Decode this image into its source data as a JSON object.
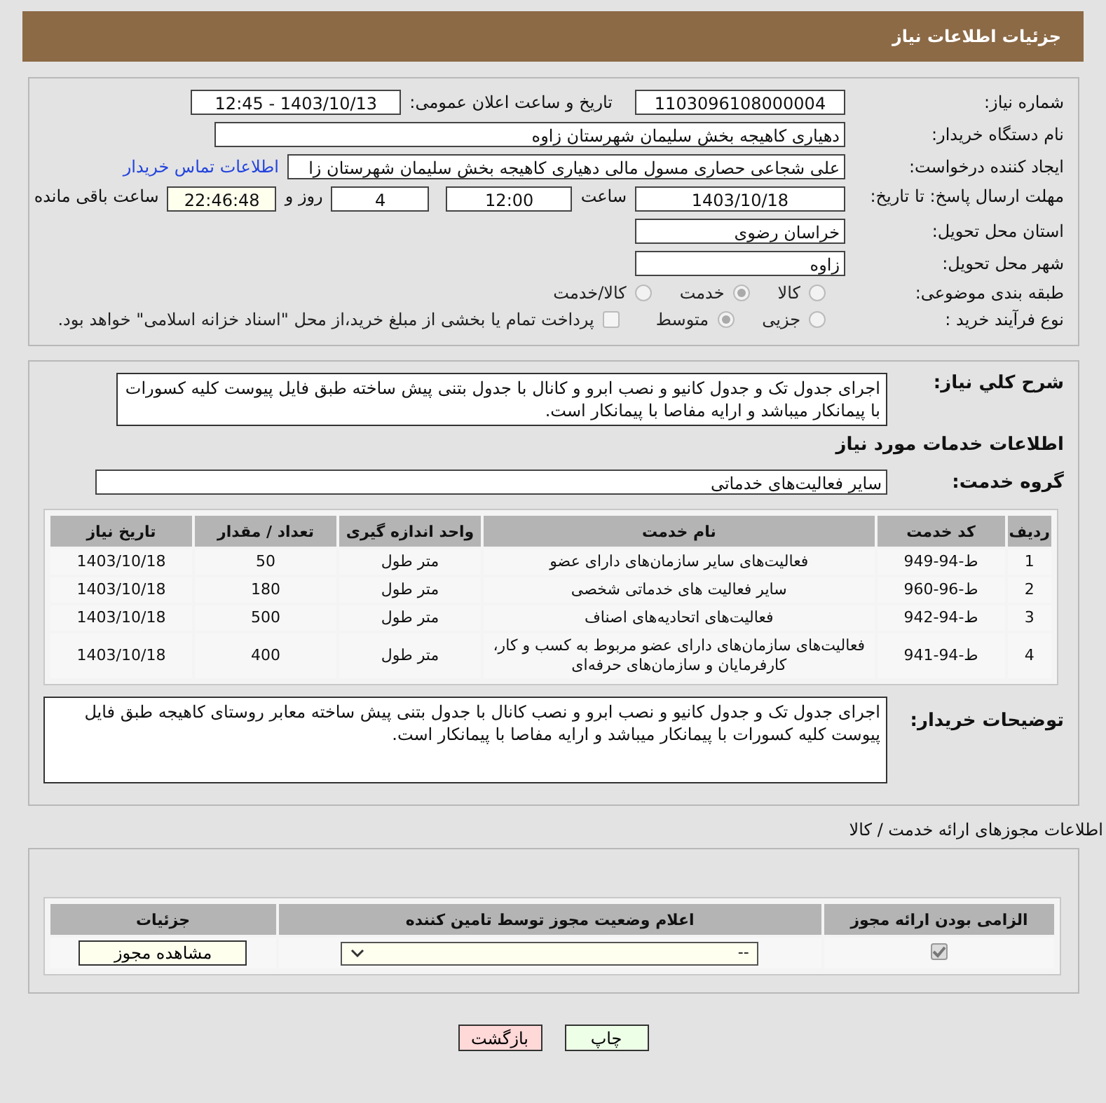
{
  "header": {
    "title": "جزئیات اطلاعات نیاز"
  },
  "details": {
    "need_number": {
      "label": "شماره نیاز:",
      "value": "1103096108000004"
    },
    "announce": {
      "label": "تاریخ و ساعت اعلان عمومی:",
      "value": "1403/10/13 - 12:45"
    },
    "buyer_org": {
      "label": "نام دستگاه خریدار:",
      "value": "دهیاری کاهیجه بخش سلیمان شهرستان زاوه"
    },
    "creator": {
      "label": "ایجاد کننده درخواست:",
      "value": "علی شجاعی حصاری مسول مالی دهیاری کاهیجه بخش سلیمان شهرستان زا",
      "link": "اطلاعات تماس خریدار"
    },
    "deadline": {
      "label": "مهلت ارسال پاسخ: تا تاریخ:",
      "date": "1403/10/18",
      "time_label": "ساعت",
      "time": "12:00",
      "days": "4",
      "days_label": "روز و",
      "remaining": "22:46:48",
      "remaining_label": "ساعت باقی مانده"
    },
    "province": {
      "label": "استان محل تحویل:",
      "value": "خراسان رضوی"
    },
    "city": {
      "label": "شهر محل تحویل:",
      "value": "زاوه"
    },
    "category": {
      "label": "طبقه بندی موضوعی:",
      "options": [
        {
          "label": "کالا",
          "selected": false
        },
        {
          "label": "خدمت",
          "selected": true
        },
        {
          "label": "کالا/خدمت",
          "selected": false
        }
      ]
    },
    "process": {
      "label": "نوع فرآیند خرید :",
      "options": [
        {
          "label": "جزیی",
          "selected": false
        },
        {
          "label": "متوسط",
          "selected": true
        }
      ],
      "payment": {
        "checked": false,
        "text": "پرداخت تمام یا بخشی از مبلغ خرید،از محل \"اسناد خزانه اسلامی\" خواهد بود."
      }
    }
  },
  "services": {
    "summary_label": "شرح کلي نياز:",
    "summary": "اجرای جدول تک و جدول کانیو و نصب ابرو و کانال با جدول بتنی پیش ساخته طبق فایل پیوست کلیه کسورات با پیمانکار میباشد و ارایه مفاصا با پیمانکار است.",
    "heading": "اطلاعات خدمات مورد نیاز",
    "group_label": "گروه خدمت:",
    "group": "سایر فعالیت‌های خدماتی",
    "table": {
      "columns": [
        "ردیف",
        "کد خدمت",
        "نام خدمت",
        "واحد اندازه گیری",
        "تعداد / مقدار",
        "تاریخ نیاز"
      ],
      "rows": [
        [
          "1",
          "ط-94-949",
          "فعالیت‌های سایر سازمان‌های دارای عضو",
          "متر طول",
          "50",
          "1403/10/18"
        ],
        [
          "2",
          "ط-96-960",
          "سایر فعالیت های خدماتی شخصی",
          "متر طول",
          "180",
          "1403/10/18"
        ],
        [
          "3",
          "ط-94-942",
          "فعالیت‌های اتحادیه‌های اصناف",
          "متر طول",
          "500",
          "1403/10/18"
        ],
        [
          "4",
          "ط-94-941",
          "فعالیت‌های سازمان‌های دارای عضو مربوط به کسب و کار، کارفرمایان و سازمان‌های حرفه‌ای",
          "متر طول",
          "400",
          "1403/10/18"
        ]
      ]
    },
    "notes_label": "توضیحات خریدار:",
    "notes": "اجرای جدول تک و جدول کانیو و نصب ابرو و نصب کانال با جدول بتنی پیش ساخته معابر روستای کاهیجه طبق فایل پیوست کلیه کسورات با پیمانکار میباشد و ارایه مفاصا با پیمانکار است."
  },
  "licenses": {
    "title": "اطلاعات مجوزهای ارائه خدمت / کالا",
    "columns": [
      "الزامی بودن ارائه مجوز",
      "اعلام وضعیت مجوز توسط تامین کننده",
      "جزئیات"
    ],
    "row": {
      "required": true,
      "status": "--",
      "button": "مشاهده مجوز"
    }
  },
  "buttons": [
    {
      "label": "چاپ",
      "kind": "print"
    },
    {
      "label": "بازگشت",
      "kind": "back"
    }
  ]
}
